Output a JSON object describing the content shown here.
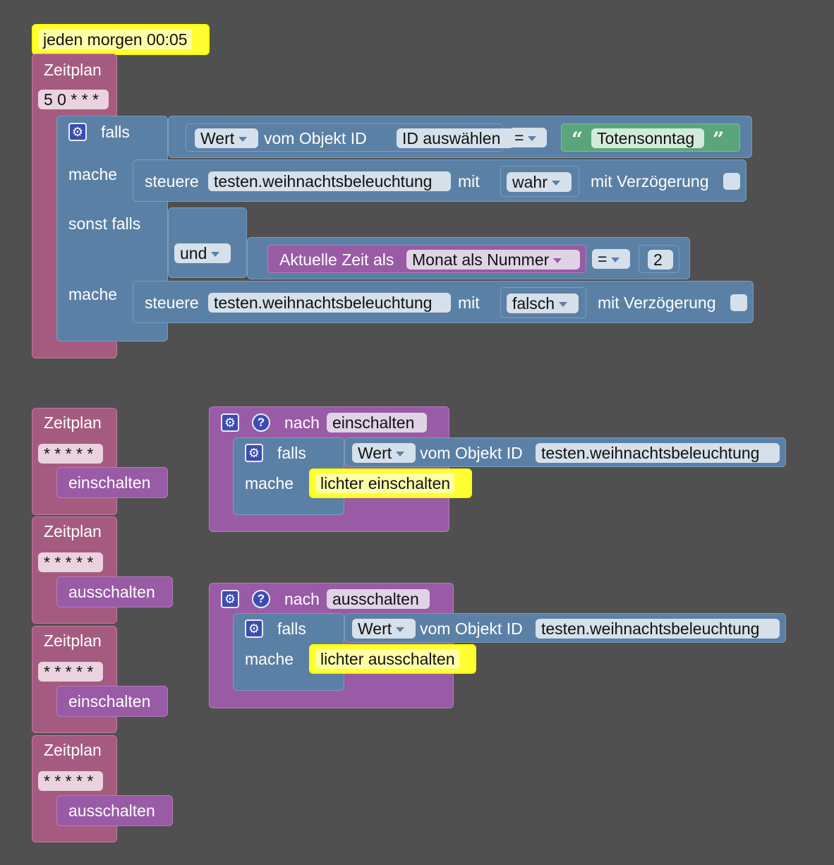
{
  "group1": {
    "event_label": "jeden morgen 00:05",
    "schedule_label": "Zeitplan",
    "cron": "5 0 * * *",
    "if_label": "falls",
    "value_dropdown": "Wert",
    "from_object_label": "vom Objekt ID",
    "object_id_placeholder": "ID auswählen",
    "eq_operator": "=",
    "text_value": "Totensonntag",
    "open_quote": "“",
    "close_quote": "”",
    "do1_label": "mache",
    "control_label": "steuere",
    "target_object": "testen.weihnachtsbeleuchtung",
    "with_label": "mit",
    "value_true": "wahr",
    "delay_label": "mit Verzögerung",
    "elseif_label": "sonst falls",
    "and_dropdown": "und",
    "time_label": "Aktuelle Zeit als",
    "month_dropdown": "Monat als Nummer",
    "eq_operator2": "=",
    "number_value": "2",
    "do2_label": "mache",
    "value_false": "falsch"
  },
  "schedules": [
    {
      "label": "Zeitplan",
      "cron": "* * * * *",
      "call": "einschalten"
    },
    {
      "label": "Zeitplan",
      "cron": "* * * * *",
      "call": "ausschalten"
    },
    {
      "label": "Zeitplan",
      "cron": "* * * * *",
      "call": "einschalten"
    },
    {
      "label": "Zeitplan",
      "cron": "* * * * *",
      "call": "ausschalten"
    }
  ],
  "functions": [
    {
      "to_label": "nach",
      "name": "einschalten",
      "if_label": "falls",
      "value_dropdown": "Wert",
      "from_object_label": "vom Objekt ID",
      "object_id": "testen.weihnachtsbeleuchtung",
      "do_label": "mache",
      "comment": "lichter einschalten"
    },
    {
      "to_label": "nach",
      "name": "ausschalten",
      "if_label": "falls",
      "value_dropdown": "Wert",
      "from_object_label": "vom Objekt ID",
      "object_id": "testen.weihnachtsbeleuchtung",
      "do_label": "mache",
      "comment": "lichter ausschalten"
    }
  ],
  "icons": {
    "gear": "gear-icon",
    "help": "help-icon"
  },
  "colors": {
    "background": "#505050",
    "event_pink": "#a55b80",
    "logic_blue": "#5b80a5",
    "procedure_purple": "#995ba5",
    "text_green": "#5ba57a",
    "comment_yellow": "#ffff33"
  }
}
